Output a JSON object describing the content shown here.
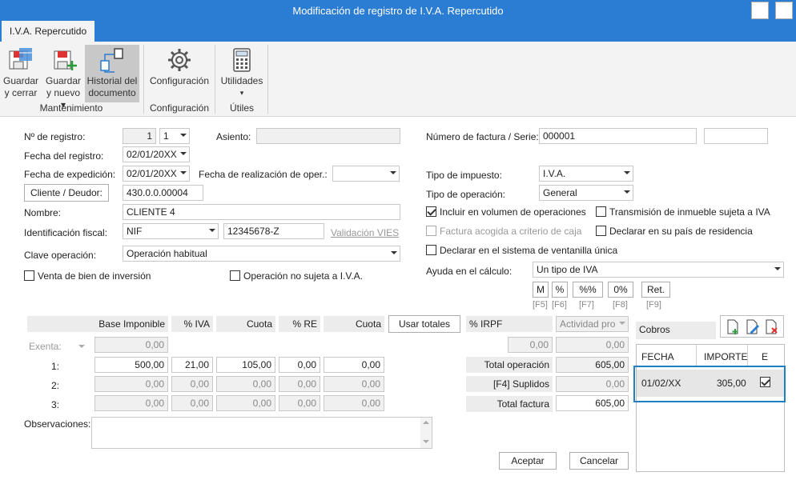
{
  "window": {
    "title": "Modificación de registro de I.V.A. Repercutido",
    "minimize": "▬",
    "close": "✕"
  },
  "tab": "I.V.A. Repercutido",
  "ribbon": {
    "guardar_cerrar": [
      "Guardar",
      "y cerrar"
    ],
    "guardar_nuevo": [
      "Guardar",
      "y nuevo ▾"
    ],
    "historial": [
      "Historial del",
      "documento"
    ],
    "configuracion": "Configuración",
    "utilidades": "Utilidades",
    "utilidades_arrow": "▾",
    "groups": {
      "mantenimiento": "Mantenimiento",
      "configuracion": "Configuración",
      "utiles": "Útiles"
    }
  },
  "form": {
    "n_registro_label": "Nº de registro:",
    "n_registro": "1",
    "n_registro_combo": "1",
    "asiento_label": "Asiento:",
    "fecha_registro_label": "Fecha del registro:",
    "fecha_registro": "02/01/20XX",
    "fecha_expedicion_label": "Fecha de expedición:",
    "fecha_expedicion": "02/01/20XX",
    "fecha_realizacion_label": "Fecha de realización de oper.:",
    "cliente_button": "Cliente / Deudor:",
    "cliente_cuenta": "430.0.0.00004",
    "nombre_label": "Nombre:",
    "nombre": "CLIENTE 4",
    "ident_label": "Identificación fiscal:",
    "ident_tipo": "NIF",
    "ident_valor": "12345678-Z",
    "validacion_vies": "Validación VIES",
    "clave_label": "Clave operación:",
    "clave": "Operación habitual",
    "venta_bien": "Venta de bien de inversión",
    "no_sujeta": "Operación no sujeta a I.V.A.",
    "factura_label": "Número de factura / Serie:",
    "factura": "000001",
    "tipo_impuesto_label": "Tipo de impuesto:",
    "tipo_impuesto": "I.V.A.",
    "tipo_operacion_label": "Tipo de operación:",
    "tipo_operacion": "General",
    "incluir_volumen": "Incluir en volumen de operaciones",
    "transmision_inmueble": "Transmisión de inmueble sujeta a IVA",
    "factura_caja": "Factura acogida a criterio de caja",
    "declarar_pais": "Declarar en su país de residencia",
    "declarar_ventanilla": "Declarar en el sistema de ventanilla única",
    "ayuda_label": "Ayuda en el cálculo:",
    "ayuda": "Un tipo de IVA",
    "calc_buttons": [
      {
        "label": "M",
        "key": "[F5]"
      },
      {
        "label": "%",
        "key": "[F6]"
      },
      {
        "label": "%%",
        "key": "[F7]"
      },
      {
        "label": "0%",
        "key": "[F8]"
      },
      {
        "label": "Ret.",
        "key": "[F9]"
      }
    ]
  },
  "table": {
    "headers": {
      "base": "Base Imponible",
      "iva": "% IVA",
      "cuota": "Cuota",
      "re": "% RE",
      "cuota_re": "Cuota"
    },
    "usar_totales": "Usar totales",
    "irpf": "% IRPF",
    "actividad": "Actividad pro",
    "exenta": "Exenta:",
    "exenta_base": "0,00",
    "rows": [
      {
        "label": "1:",
        "base": "500,00",
        "iva": "21,00",
        "cuota": "105,00",
        "re": "0,00",
        "cuota_re": "0,00"
      },
      {
        "label": "2:",
        "base": "0,00",
        "iva": "0,00",
        "cuota": "0,00",
        "re": "0,00",
        "cuota_re": "0,00"
      },
      {
        "label": "3:",
        "base": "0,00",
        "iva": "0,00",
        "cuota": "0,00",
        "re": "0,00",
        "cuota_re": "0,00"
      }
    ],
    "irpf_pct": "0,00",
    "irpf_importe": "0,00",
    "total_operacion_label": "Total operación",
    "total_operacion": "605,00",
    "suplidos_label": "[F4] Suplidos",
    "suplidos": "0,00",
    "total_factura_label": "Total factura",
    "total_factura": "605,00"
  },
  "observaciones_label": "Observaciones:",
  "cobros": {
    "title": "Cobros",
    "headers": {
      "fecha": "FECHA",
      "importe": "IMPORTE",
      "e": "E"
    },
    "rows": [
      {
        "fecha": "01/02/XX",
        "importe": "305,00",
        "e": true
      }
    ]
  },
  "actions": {
    "aceptar": "Aceptar",
    "cancelar": "Cancelar"
  },
  "colors": {
    "titlebar": "#2b7cd3",
    "highlight": "#1f7fc0"
  }
}
